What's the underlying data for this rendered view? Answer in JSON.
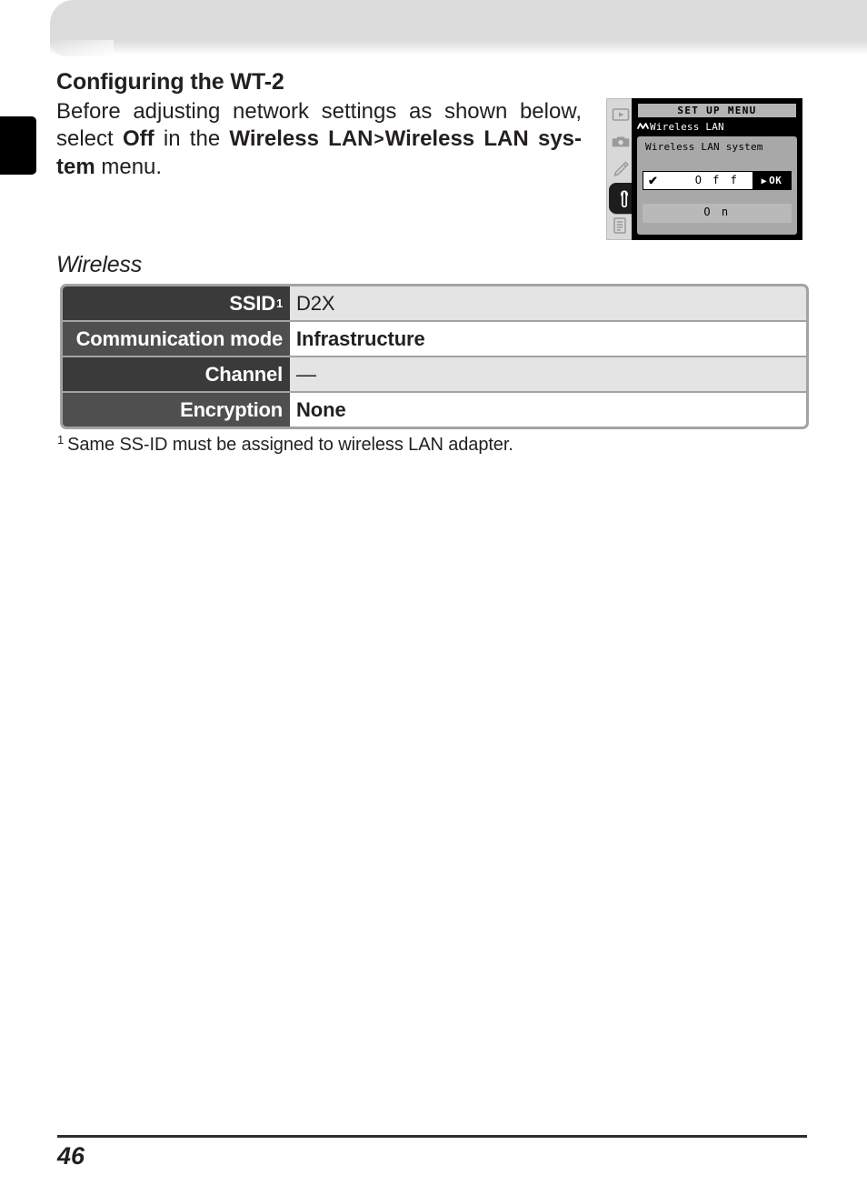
{
  "page": {
    "number": "46",
    "chapter_tab": "black-chapter-tab"
  },
  "section": {
    "title": "Configuring the WT-2",
    "intro_part1": "Before adjusting network settings as shown below, select ",
    "intro_off": "Off",
    "intro_part2": " in the ",
    "intro_menu1": "Wireless LAN",
    "intro_separator": ">",
    "intro_menu2": "Wireless LAN sys-",
    "intro_menu3": "tem",
    "intro_part3": " menu."
  },
  "lcd": {
    "title": "SET UP MENU",
    "breadcrumb": "Wireless LAN",
    "subtitle": "Wireless LAN system",
    "selected_option": "O f f",
    "selected_check": "✔",
    "ok_arrow": "▶",
    "ok_label": "OK",
    "other_option": "O n",
    "icons": [
      {
        "name": "playback-icon",
        "glyph": "play-in-box"
      },
      {
        "name": "shooting-menu-icon",
        "glyph": "camera"
      },
      {
        "name": "custom-settings-icon",
        "glyph": "pencil"
      },
      {
        "name": "setup-menu-icon",
        "glyph": "wrench",
        "selected": true
      },
      {
        "name": "recent-settings-icon",
        "glyph": "document-stack"
      }
    ]
  },
  "table": {
    "heading": "Wireless",
    "rows": [
      {
        "label": "SSID",
        "sup": "1",
        "value": "D2X"
      },
      {
        "label": "Communication mode",
        "sup": "",
        "value": "Infrastructure"
      },
      {
        "label": "Channel",
        "sup": "",
        "value": "—"
      },
      {
        "label": "Encryption",
        "sup": "",
        "value": "None"
      }
    ],
    "footnote_marker": "1",
    "footnote_text": "Same SS-ID must be assigned to wireless LAN adapter."
  },
  "colors": {
    "label_dark": "#3a3a3a",
    "label_light": "#4f4f4f",
    "value_shade": "#e4e4e4",
    "value_white": "#ffffff",
    "table_border": "#a3a3a3",
    "header_band": "#dcdcdc",
    "text": "#231f20"
  }
}
